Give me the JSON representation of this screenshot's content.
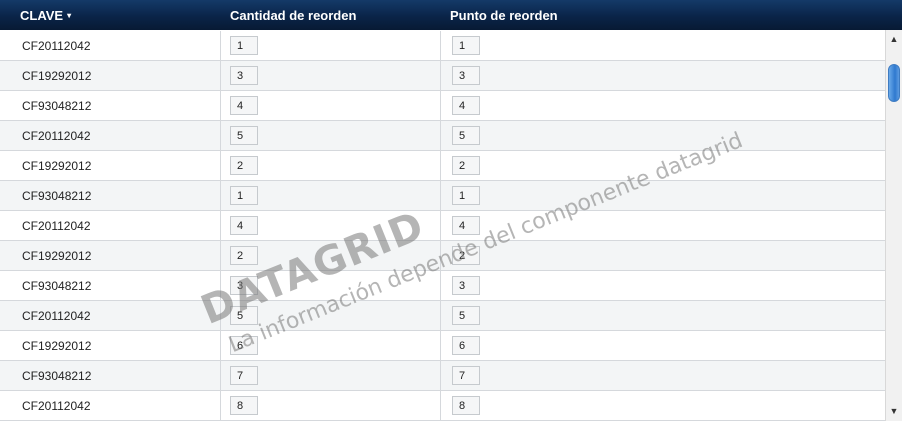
{
  "header": {
    "col_clave": "CLAVE",
    "sort_indicator": "▾",
    "col_cantidad": "Cantidad de reorden",
    "col_punto": "Punto de reorden"
  },
  "rows": [
    {
      "clave": "CF20112042",
      "cantidad": "1",
      "punto": "1"
    },
    {
      "clave": "CF19292012",
      "cantidad": "3",
      "punto": "3"
    },
    {
      "clave": "CF93048212",
      "cantidad": "4",
      "punto": "4"
    },
    {
      "clave": "CF20112042",
      "cantidad": "5",
      "punto": "5"
    },
    {
      "clave": "CF19292012",
      "cantidad": "2",
      "punto": "2"
    },
    {
      "clave": "CF93048212",
      "cantidad": "1",
      "punto": "1"
    },
    {
      "clave": "CF20112042",
      "cantidad": "4",
      "punto": "4"
    },
    {
      "clave": "CF19292012",
      "cantidad": "2",
      "punto": "2"
    },
    {
      "clave": "CF93048212",
      "cantidad": "3",
      "punto": "3"
    },
    {
      "clave": "CF20112042",
      "cantidad": "5",
      "punto": "5"
    },
    {
      "clave": "CF19292012",
      "cantidad": "6",
      "punto": "6"
    },
    {
      "clave": "CF93048212",
      "cantidad": "7",
      "punto": "7"
    },
    {
      "clave": "CF20112042",
      "cantidad": "8",
      "punto": "8"
    }
  ],
  "scrollbar": {
    "up_icon": "▲",
    "down_icon": "▼"
  },
  "watermark": {
    "title": "DATAGRID",
    "subtitle": "La información depende del componente datagrid"
  },
  "colors": {
    "header_bg": "#0a2448",
    "thumb": "#2f79cf",
    "row_alt": "#f3f5f6"
  }
}
